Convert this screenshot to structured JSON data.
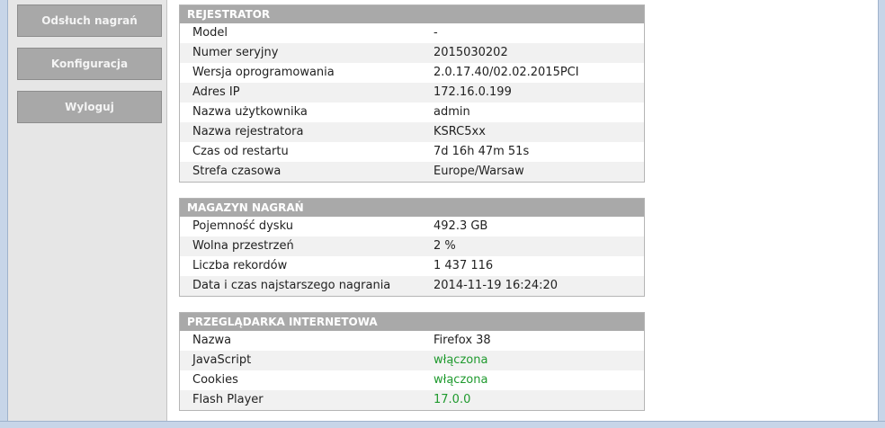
{
  "nav": {
    "recordings_label": "Odsłuch nagrań",
    "config_label": "Konfiguracja",
    "logout_label": "Wyloguj"
  },
  "recorder": {
    "title": "REJESTRATOR",
    "rows": [
      {
        "label": "Model",
        "value": "-"
      },
      {
        "label": "Numer seryjny",
        "value": "2015030202"
      },
      {
        "label": "Wersja oprogramowania",
        "value": "2.0.17.40/02.02.2015PCI"
      },
      {
        "label": "Adres IP",
        "value": "172.16.0.199"
      },
      {
        "label": "Nazwa użytkownika",
        "value": "admin"
      },
      {
        "label": "Nazwa rejestratora",
        "value": "KSRC5xx"
      },
      {
        "label": "Czas od restartu",
        "value": "7d 16h 47m 51s"
      },
      {
        "label": "Strefa czasowa",
        "value": "Europe/Warsaw"
      }
    ]
  },
  "storage": {
    "title": "MAGAZYN NAGRAŃ",
    "rows": [
      {
        "label": "Pojemność dysku",
        "value": "492.3 GB"
      },
      {
        "label": "Wolna przestrzeń",
        "value": "2 %"
      },
      {
        "label": "Liczba rekordów",
        "value": "1 437 116"
      },
      {
        "label": "Data i czas najstarszego nagrania",
        "value": "2014-11-19 16:24:20"
      }
    ]
  },
  "browser": {
    "title": "PRZEGLĄDARKA INTERNETOWA",
    "rows": [
      {
        "label": "Nazwa",
        "value": "Firefox 38"
      },
      {
        "label": "JavaScript",
        "value": "włączona"
      },
      {
        "label": "Cookies",
        "value": "włączona"
      },
      {
        "label": "Flash Player",
        "value": "17.0.0"
      }
    ]
  },
  "colors": {
    "status_ok": "#1f9a2e",
    "header_bg": "#a9a9a9",
    "button_bg": "#a8a8a8"
  }
}
